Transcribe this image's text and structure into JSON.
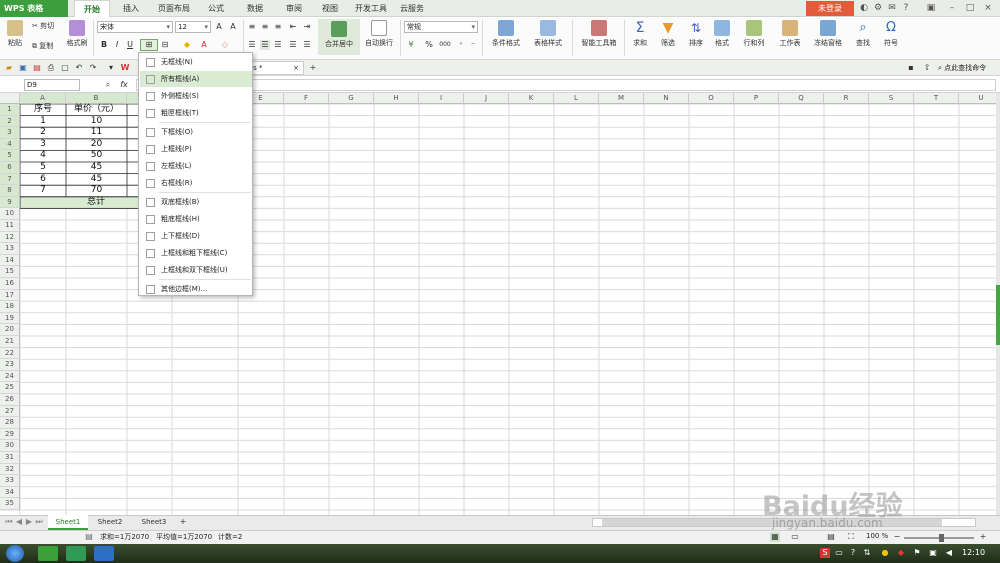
{
  "app": {
    "logo": "WPS 表格",
    "login": "未登录"
  },
  "menu_tabs": [
    "开始",
    "插入",
    "页面布局",
    "公式",
    "数据",
    "审阅",
    "视图",
    "开发工具",
    "云服务"
  ],
  "ribbon": {
    "paste": "粘贴",
    "cut": "剪切",
    "copy": "复制",
    "format_painter": "格式刷",
    "font": "宋体",
    "font_size": "12",
    "bold": "B",
    "italic": "I",
    "underline": "U",
    "merge_center": "合并居中",
    "wrap": "自动换行",
    "number_format": "常规",
    "conditional": "条件格式",
    "table_style": "表格样式",
    "smart_tools": "智能工具箱",
    "sum": "求和",
    "filter": "筛选",
    "sort": "排序",
    "format": "格式",
    "rows_cols": "行和列",
    "worksheet": "工作表",
    "freeze": "冻结窗格",
    "find": "查找",
    "symbol": "符号",
    "percent": "%",
    "comma": "000"
  },
  "quickbar": {
    "file_tab": "xls *",
    "help": "点此查找命令"
  },
  "formula_bar": {
    "name_box": "D9",
    "fx": "fx"
  },
  "columns": [
    "A",
    "B",
    "C",
    "D",
    "E",
    "F",
    "G",
    "H",
    "I",
    "J",
    "K",
    "L",
    "M",
    "N",
    "O",
    "P",
    "Q",
    "R",
    "S",
    "T",
    "U"
  ],
  "rows": [
    "1",
    "2",
    "3",
    "4",
    "5",
    "6",
    "7",
    "8",
    "9",
    "10",
    "11",
    "12",
    "13",
    "14",
    "15",
    "16",
    "17",
    "18",
    "19",
    "20",
    "21",
    "22",
    "23",
    "24",
    "25",
    "26",
    "27",
    "28",
    "29",
    "30",
    "31",
    "32",
    "33",
    "34",
    "35"
  ],
  "table": {
    "header": [
      "序号",
      "单价（元）"
    ],
    "data": [
      [
        "1",
        "10"
      ],
      [
        "2",
        "11"
      ],
      [
        "3",
        "20"
      ],
      [
        "4",
        "50"
      ],
      [
        "5",
        "45"
      ],
      [
        "6",
        "45"
      ],
      [
        "7",
        "70"
      ]
    ],
    "total": "总计"
  },
  "border_menu": [
    "无框线(N)",
    "所有框线(A)",
    "外侧框线(S)",
    "粗匣框线(T)",
    "下框线(O)",
    "上框线(P)",
    "左框线(L)",
    "右框线(R)",
    "双底框线(B)",
    "粗底框线(H)",
    "上下框线(D)",
    "上框线和粗下框线(C)",
    "上框线和双下框线(U)",
    "其他边框(M)..."
  ],
  "sheets": [
    "Sheet1",
    "Sheet2",
    "Sheet3"
  ],
  "status": {
    "sum": "求和=1万2070",
    "avg": "平均值=1万2070",
    "count": "计数=2",
    "zoom": "100 %"
  },
  "taskbar": {
    "clock": "12:10"
  },
  "colors": {
    "accent": "#3c9e3c",
    "login": "#e25c3c",
    "highlight": "#d9ebd3"
  },
  "watermark": {
    "brand": "Baidu经验",
    "url": "jingyan.baidu.com"
  }
}
